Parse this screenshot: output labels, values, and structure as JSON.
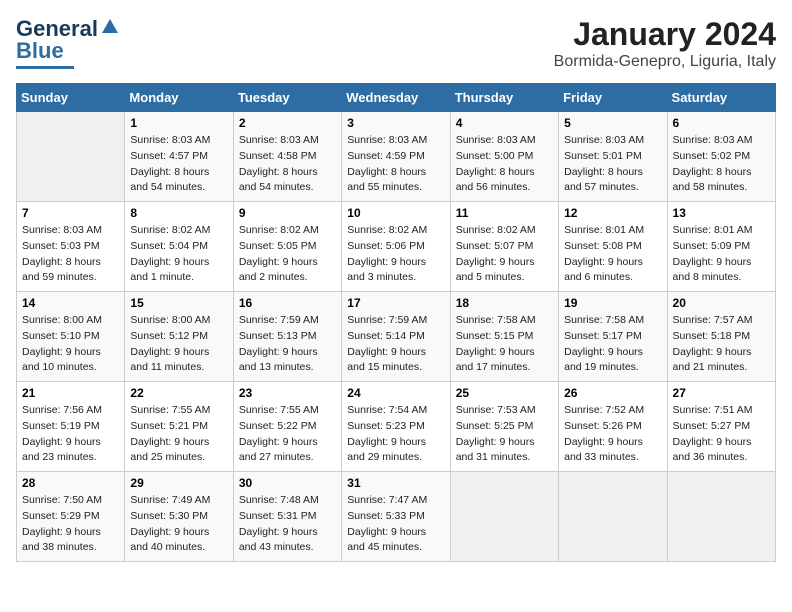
{
  "header": {
    "logo_line1": "General",
    "logo_line2": "Blue",
    "month": "January 2024",
    "location": "Bormida-Genepro, Liguria, Italy"
  },
  "weekdays": [
    "Sunday",
    "Monday",
    "Tuesday",
    "Wednesday",
    "Thursday",
    "Friday",
    "Saturday"
  ],
  "weeks": [
    [
      {
        "day": "",
        "info": ""
      },
      {
        "day": "1",
        "info": "Sunrise: 8:03 AM\nSunset: 4:57 PM\nDaylight: 8 hours\nand 54 minutes."
      },
      {
        "day": "2",
        "info": "Sunrise: 8:03 AM\nSunset: 4:58 PM\nDaylight: 8 hours\nand 54 minutes."
      },
      {
        "day": "3",
        "info": "Sunrise: 8:03 AM\nSunset: 4:59 PM\nDaylight: 8 hours\nand 55 minutes."
      },
      {
        "day": "4",
        "info": "Sunrise: 8:03 AM\nSunset: 5:00 PM\nDaylight: 8 hours\nand 56 minutes."
      },
      {
        "day": "5",
        "info": "Sunrise: 8:03 AM\nSunset: 5:01 PM\nDaylight: 8 hours\nand 57 minutes."
      },
      {
        "day": "6",
        "info": "Sunrise: 8:03 AM\nSunset: 5:02 PM\nDaylight: 8 hours\nand 58 minutes."
      }
    ],
    [
      {
        "day": "7",
        "info": "Sunrise: 8:03 AM\nSunset: 5:03 PM\nDaylight: 8 hours\nand 59 minutes."
      },
      {
        "day": "8",
        "info": "Sunrise: 8:02 AM\nSunset: 5:04 PM\nDaylight: 9 hours\nand 1 minute."
      },
      {
        "day": "9",
        "info": "Sunrise: 8:02 AM\nSunset: 5:05 PM\nDaylight: 9 hours\nand 2 minutes."
      },
      {
        "day": "10",
        "info": "Sunrise: 8:02 AM\nSunset: 5:06 PM\nDaylight: 9 hours\nand 3 minutes."
      },
      {
        "day": "11",
        "info": "Sunrise: 8:02 AM\nSunset: 5:07 PM\nDaylight: 9 hours\nand 5 minutes."
      },
      {
        "day": "12",
        "info": "Sunrise: 8:01 AM\nSunset: 5:08 PM\nDaylight: 9 hours\nand 6 minutes."
      },
      {
        "day": "13",
        "info": "Sunrise: 8:01 AM\nSunset: 5:09 PM\nDaylight: 9 hours\nand 8 minutes."
      }
    ],
    [
      {
        "day": "14",
        "info": "Sunrise: 8:00 AM\nSunset: 5:10 PM\nDaylight: 9 hours\nand 10 minutes."
      },
      {
        "day": "15",
        "info": "Sunrise: 8:00 AM\nSunset: 5:12 PM\nDaylight: 9 hours\nand 11 minutes."
      },
      {
        "day": "16",
        "info": "Sunrise: 7:59 AM\nSunset: 5:13 PM\nDaylight: 9 hours\nand 13 minutes."
      },
      {
        "day": "17",
        "info": "Sunrise: 7:59 AM\nSunset: 5:14 PM\nDaylight: 9 hours\nand 15 minutes."
      },
      {
        "day": "18",
        "info": "Sunrise: 7:58 AM\nSunset: 5:15 PM\nDaylight: 9 hours\nand 17 minutes."
      },
      {
        "day": "19",
        "info": "Sunrise: 7:58 AM\nSunset: 5:17 PM\nDaylight: 9 hours\nand 19 minutes."
      },
      {
        "day": "20",
        "info": "Sunrise: 7:57 AM\nSunset: 5:18 PM\nDaylight: 9 hours\nand 21 minutes."
      }
    ],
    [
      {
        "day": "21",
        "info": "Sunrise: 7:56 AM\nSunset: 5:19 PM\nDaylight: 9 hours\nand 23 minutes."
      },
      {
        "day": "22",
        "info": "Sunrise: 7:55 AM\nSunset: 5:21 PM\nDaylight: 9 hours\nand 25 minutes."
      },
      {
        "day": "23",
        "info": "Sunrise: 7:55 AM\nSunset: 5:22 PM\nDaylight: 9 hours\nand 27 minutes."
      },
      {
        "day": "24",
        "info": "Sunrise: 7:54 AM\nSunset: 5:23 PM\nDaylight: 9 hours\nand 29 minutes."
      },
      {
        "day": "25",
        "info": "Sunrise: 7:53 AM\nSunset: 5:25 PM\nDaylight: 9 hours\nand 31 minutes."
      },
      {
        "day": "26",
        "info": "Sunrise: 7:52 AM\nSunset: 5:26 PM\nDaylight: 9 hours\nand 33 minutes."
      },
      {
        "day": "27",
        "info": "Sunrise: 7:51 AM\nSunset: 5:27 PM\nDaylight: 9 hours\nand 36 minutes."
      }
    ],
    [
      {
        "day": "28",
        "info": "Sunrise: 7:50 AM\nSunset: 5:29 PM\nDaylight: 9 hours\nand 38 minutes."
      },
      {
        "day": "29",
        "info": "Sunrise: 7:49 AM\nSunset: 5:30 PM\nDaylight: 9 hours\nand 40 minutes."
      },
      {
        "day": "30",
        "info": "Sunrise: 7:48 AM\nSunset: 5:31 PM\nDaylight: 9 hours\nand 43 minutes."
      },
      {
        "day": "31",
        "info": "Sunrise: 7:47 AM\nSunset: 5:33 PM\nDaylight: 9 hours\nand 45 minutes."
      },
      {
        "day": "",
        "info": ""
      },
      {
        "day": "",
        "info": ""
      },
      {
        "day": "",
        "info": ""
      }
    ]
  ]
}
